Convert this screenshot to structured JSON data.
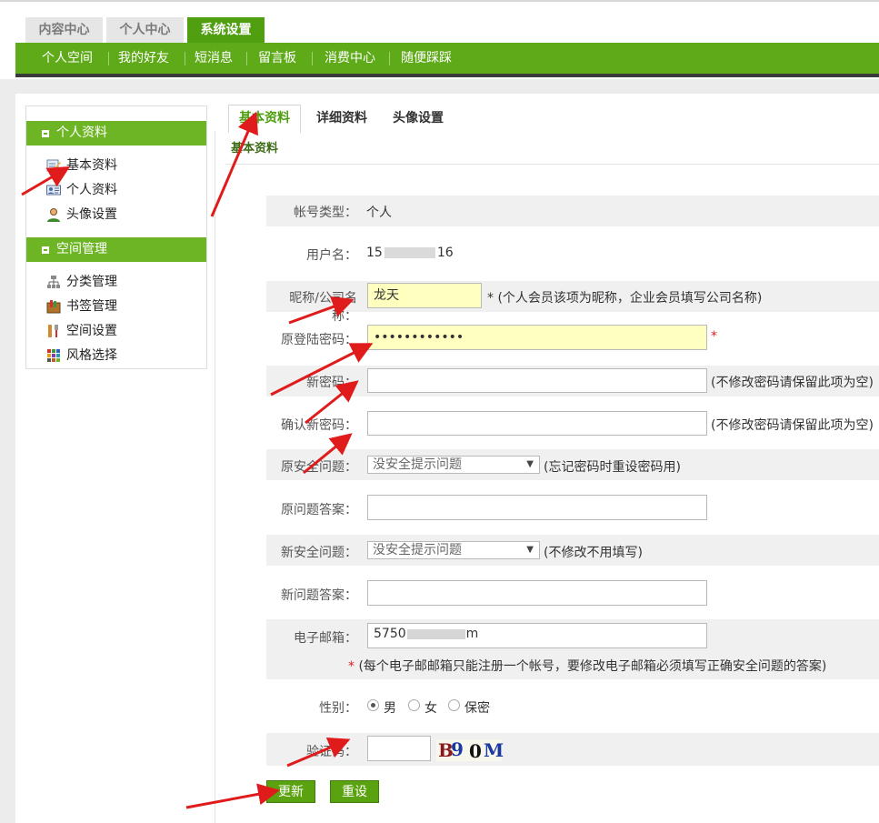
{
  "top_tabs": [
    {
      "label": "内容中心"
    },
    {
      "label": "个人中心"
    },
    {
      "label": "系统设置"
    }
  ],
  "nav": [
    {
      "label": "个人空间"
    },
    {
      "label": "我的好友"
    },
    {
      "label": "短消息"
    },
    {
      "label": "留言板"
    },
    {
      "label": "消费中心"
    },
    {
      "label": "随便踩踩"
    }
  ],
  "sidebar": {
    "sections": [
      {
        "title": "个人资料",
        "items": [
          {
            "label": "基本资料",
            "icon": "edit-icon"
          },
          {
            "label": "个人资料",
            "icon": "id-card-icon"
          },
          {
            "label": "头像设置",
            "icon": "avatar-icon"
          }
        ]
      },
      {
        "title": "空间管理",
        "items": [
          {
            "label": "分类管理",
            "icon": "sitemap-icon"
          },
          {
            "label": "书签管理",
            "icon": "bookmark-icon"
          },
          {
            "label": "空间设置",
            "icon": "tools-icon"
          },
          {
            "label": "风格选择",
            "icon": "palette-icon"
          }
        ]
      }
    ]
  },
  "sub_tabs": [
    {
      "label": "基本资料"
    },
    {
      "label": "详细资料"
    },
    {
      "label": "头像设置"
    }
  ],
  "section_title": "基本资料",
  "form": {
    "account_type": {
      "label": "帐号类型：",
      "value": "个人"
    },
    "username": {
      "label": "用户名：",
      "value": "15"
    },
    "nickname": {
      "label": "昵称/公司名称：",
      "value": "龙天",
      "hint": "* (个人会员该项为昵称，企业会员填写公司名称)"
    },
    "old_password": {
      "label": "原登陆密码：",
      "value": "••••••••••••",
      "required": "*"
    },
    "new_password": {
      "label": "新密码：",
      "value": "",
      "hint": "(不修改密码请保留此项为空)"
    },
    "confirm_password": {
      "label": "确认新密码：",
      "value": "",
      "hint": "(不修改密码请保留此项为空)"
    },
    "old_question": {
      "label": "原安全问题：",
      "selected": "没安全提示问题",
      "hint": "(忘记密码时重设密码用)"
    },
    "old_answer": {
      "label": "原问题答案：",
      "value": ""
    },
    "new_question": {
      "label": "新安全问题：",
      "selected": "没安全提示问题",
      "hint": "(不修改不用填写)"
    },
    "new_answer": {
      "label": "新问题答案：",
      "value": ""
    },
    "email": {
      "label": "电子邮箱：",
      "value": "5750",
      "note_star": "*",
      "note": "(每个电子邮邮箱只能注册一个帐号，要修改电子邮箱必须填写正确安全问题的答案)"
    },
    "gender": {
      "label": "性别：",
      "options": [
        "男",
        "女",
        "保密"
      ],
      "selected": "男"
    },
    "captcha": {
      "label": "验证码：",
      "value": "",
      "chars": [
        "B",
        "9",
        "0",
        "M"
      ]
    }
  },
  "buttons": {
    "submit": "更新",
    "reset": "重设"
  },
  "colors": {
    "green": "#5faa19",
    "arrow": "#e01b1b"
  }
}
